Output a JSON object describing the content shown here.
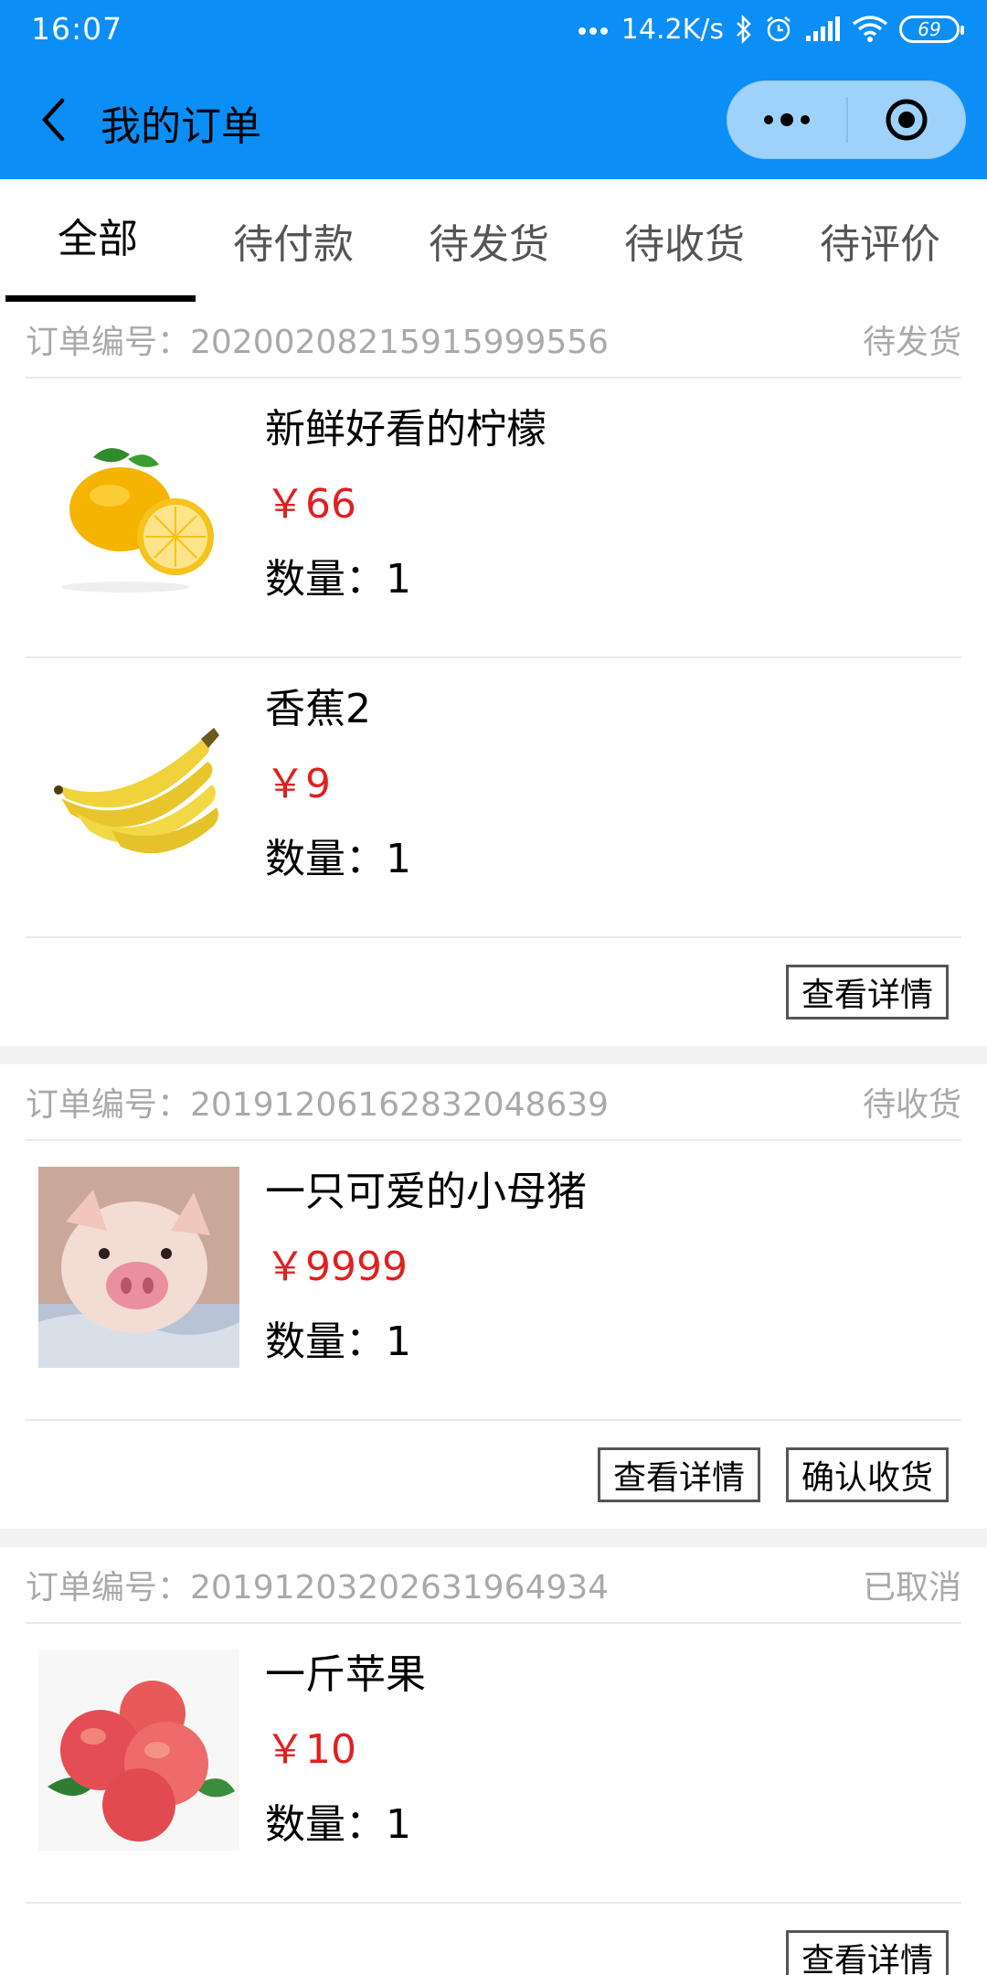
{
  "status_bar": {
    "time": "16:07",
    "network_speed": "14.2K/s",
    "battery": "69",
    "icons": [
      "dots-icon",
      "bluetooth-icon",
      "alarm-icon",
      "signal-icon",
      "wifi-icon",
      "battery-icon"
    ]
  },
  "nav": {
    "title": "我的订单",
    "back_icon": "chevron-left-icon",
    "more_icon": "more-dots-icon",
    "close_icon": "target-circle-icon"
  },
  "tabs": [
    {
      "label": "全部",
      "active": true
    },
    {
      "label": "待付款",
      "active": false
    },
    {
      "label": "待发货",
      "active": false
    },
    {
      "label": "待收货",
      "active": false
    },
    {
      "label": "待评价",
      "active": false
    }
  ],
  "orders": [
    {
      "order_no_label": "订单编号：20200208215915999556",
      "status": "待发货",
      "items": [
        {
          "name": "新鲜好看的柠檬",
          "price": "￥66",
          "qty": "数量：1",
          "image": "lemon"
        },
        {
          "name": "香蕉2",
          "price": "￥9",
          "qty": "数量：1",
          "image": "banana"
        }
      ],
      "buttons": [
        "查看详情"
      ]
    },
    {
      "order_no_label": "订单编号：20191206162832048639",
      "status": "待收货",
      "items": [
        {
          "name": "一只可爱的小母猪",
          "price": "￥9999",
          "qty": "数量：1",
          "image": "piglet"
        }
      ],
      "buttons": [
        "查看详情",
        "确认收货"
      ]
    },
    {
      "order_no_label": "订单编号：20191203202631964934",
      "status": "已取消",
      "items": [
        {
          "name": "一斤苹果",
          "price": "￥10",
          "qty": "数量：1",
          "image": "apples"
        }
      ],
      "buttons": [
        "查看详情"
      ]
    }
  ],
  "colors": {
    "brand_blue": "#0b8ef6",
    "price_red": "#e02020",
    "muted_gray": "#a9a9a9"
  }
}
